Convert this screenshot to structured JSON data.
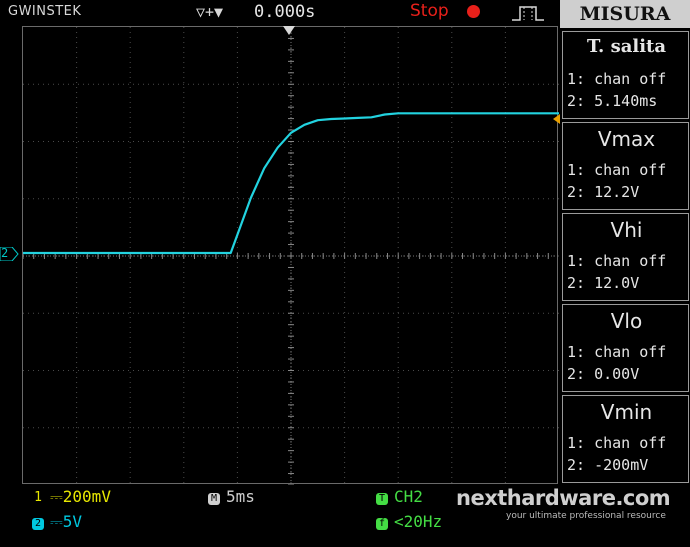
{
  "topbar": {
    "brand": "GWINSTEK",
    "trigger_icons": "▽+▼",
    "time_offset": "0.000s",
    "run_state": "Stop",
    "stop_icon": "stop-dot-icon",
    "trigger_mode_icon": "edge-trigger-icon"
  },
  "screen": {
    "ch2_marker": "2",
    "trace_color": "#22d3e0",
    "trace_points": [
      [
        0,
        0.0
      ],
      [
        1,
        0.0
      ],
      [
        2,
        0.0
      ],
      [
        3,
        0.0
      ],
      [
        4,
        0.0
      ],
      [
        5,
        0.0
      ],
      [
        6,
        0.0
      ],
      [
        7,
        0.0
      ],
      [
        8,
        0.0
      ],
      [
        9,
        0.0
      ],
      [
        10,
        0.0
      ],
      [
        11,
        0.0
      ],
      [
        12,
        0.0
      ],
      [
        13,
        0.0
      ],
      [
        14,
        0.0
      ],
      [
        15,
        0.0
      ],
      [
        15.5,
        0.0
      ],
      [
        16,
        1.6
      ],
      [
        17,
        4.8
      ],
      [
        18,
        7.4
      ],
      [
        19,
        9.2
      ],
      [
        20,
        10.5
      ],
      [
        21,
        11.2
      ],
      [
        22,
        11.6
      ],
      [
        23,
        11.7
      ],
      [
        24,
        11.75
      ],
      [
        25,
        11.8
      ],
      [
        26,
        11.85
      ],
      [
        27,
        12.1
      ],
      [
        28,
        12.2
      ],
      [
        29,
        12.2
      ],
      [
        30,
        12.2
      ],
      [
        31,
        12.2
      ],
      [
        32,
        12.2
      ],
      [
        33,
        12.2
      ],
      [
        34,
        12.2
      ],
      [
        35,
        12.2
      ],
      [
        36,
        12.2
      ],
      [
        37,
        12.2
      ],
      [
        38,
        12.2
      ],
      [
        39,
        12.2
      ],
      [
        40,
        12.2
      ]
    ]
  },
  "panel": {
    "title": "MISURA",
    "measurements": [
      {
        "name": "T. salita",
        "line1": "1: chan off",
        "line2": "2: 5.140ms"
      },
      {
        "name": "Vmax",
        "line1": "1: chan off",
        "line2": "2: 12.2V"
      },
      {
        "name": "Vhi",
        "line1": "1: chan off",
        "line2": "2: 12.0V"
      },
      {
        "name": "Vlo",
        "line1": "1: chan off",
        "line2": "2: 0.00V"
      },
      {
        "name": "Vmin",
        "line1": "1: chan off",
        "line2": "2: -200mV"
      }
    ]
  },
  "bottom": {
    "ch1": {
      "badge": "1",
      "coupling": "⎓",
      "scale": "200mV",
      "color": "#e8e800"
    },
    "ch2": {
      "badge": "2",
      "coupling": "⎓",
      "scale": "5V",
      "color": "#00c8e0"
    },
    "timebase": {
      "badge": "M",
      "value": "5ms",
      "color": "#cfcfcf"
    },
    "trigger_src": {
      "badge": "T",
      "value": "CH2",
      "color": "#44dd44"
    },
    "trigger_freq": {
      "badge": "f",
      "value": "<20Hz",
      "color": "#44dd44"
    }
  },
  "watermark": {
    "title": "nexthardware.com",
    "subtitle": "your ultimate professional resource"
  }
}
